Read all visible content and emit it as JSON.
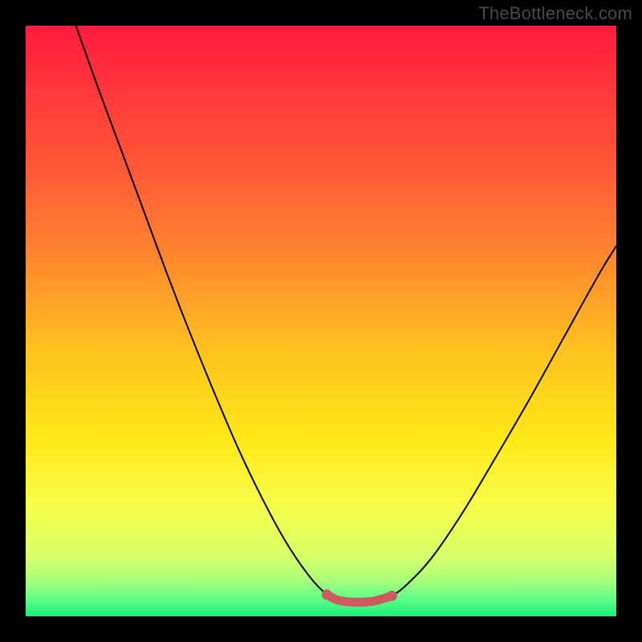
{
  "watermark": "TheBottleneck.com",
  "chart_data": {
    "type": "line",
    "title": "",
    "xlabel": "",
    "ylabel": "",
    "xlim": [
      0,
      100
    ],
    "ylim": [
      0,
      100
    ],
    "gradient": {
      "stops": [
        {
          "offset": 0,
          "color": "#ff1a3e"
        },
        {
          "offset": 12,
          "color": "#ff3a3a"
        },
        {
          "offset": 25,
          "color": "#ff5a36"
        },
        {
          "offset": 40,
          "color": "#ff8a2e"
        },
        {
          "offset": 55,
          "color": "#ffc21f"
        },
        {
          "offset": 70,
          "color": "#ffe818"
        },
        {
          "offset": 82,
          "color": "#f6ff4d"
        },
        {
          "offset": 90,
          "color": "#d6ff69"
        },
        {
          "offset": 94,
          "color": "#a7ff7a"
        },
        {
          "offset": 97,
          "color": "#5fff88"
        },
        {
          "offset": 100,
          "color": "#19f07a"
        }
      ]
    },
    "series": [
      {
        "name": "bottleneck-curve",
        "style": "thin-black",
        "points": [
          {
            "x": 8.5,
            "y": 100.0
          },
          {
            "x": 12.0,
            "y": 90.0
          },
          {
            "x": 16.0,
            "y": 79.0
          },
          {
            "x": 20.0,
            "y": 68.0
          },
          {
            "x": 24.0,
            "y": 57.0
          },
          {
            "x": 28.0,
            "y": 46.5
          },
          {
            "x": 32.0,
            "y": 36.5
          },
          {
            "x": 36.0,
            "y": 27.0
          },
          {
            "x": 40.0,
            "y": 18.5
          },
          {
            "x": 44.0,
            "y": 11.0
          },
          {
            "x": 48.0,
            "y": 5.0
          },
          {
            "x": 51.0,
            "y": 1.8
          },
          {
            "x": 53.0,
            "y": 0.8
          },
          {
            "x": 56.0,
            "y": 0.5
          },
          {
            "x": 59.0,
            "y": 0.7
          },
          {
            "x": 62.0,
            "y": 1.6
          },
          {
            "x": 65.0,
            "y": 4.0
          },
          {
            "x": 69.0,
            "y": 8.5
          },
          {
            "x": 74.0,
            "y": 16.0
          },
          {
            "x": 79.0,
            "y": 24.5
          },
          {
            "x": 85.0,
            "y": 35.0
          },
          {
            "x": 91.0,
            "y": 46.0
          },
          {
            "x": 97.0,
            "y": 57.0
          },
          {
            "x": 100.0,
            "y": 62.0
          }
        ]
      },
      {
        "name": "optimal-range-highlight",
        "style": "thick-red",
        "points": [
          {
            "x": 51.0,
            "y": 1.8
          },
          {
            "x": 53.0,
            "y": 0.8
          },
          {
            "x": 56.0,
            "y": 0.5
          },
          {
            "x": 59.0,
            "y": 0.7
          },
          {
            "x": 62.0,
            "y": 1.6
          }
        ]
      }
    ]
  }
}
